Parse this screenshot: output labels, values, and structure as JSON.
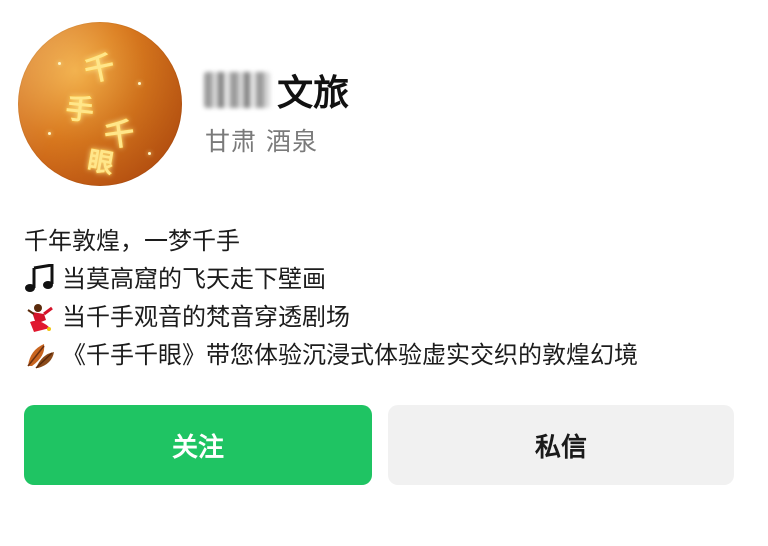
{
  "profile": {
    "name_suffix": "文旅",
    "location": "甘肃 酒泉",
    "avatar_text": [
      "千",
      "手",
      "千",
      "眼"
    ]
  },
  "bio": {
    "line1": "千年敦煌，一梦千手",
    "line2": "当莫高窟的飞天走下壁画",
    "line3": "当千手观音的梵音穿透剧场",
    "line4": "《千手千眼》带您体验沉浸式体验虚实交织的敦煌幻境",
    "icons": [
      "music-note-icon",
      "dancer-icon",
      "autumn-leaf-icon"
    ]
  },
  "actions": {
    "follow_label": "关注",
    "message_label": "私信"
  },
  "colors": {
    "follow_bg": "#1fc463",
    "message_bg": "#f1f1f1",
    "location_text": "#7a7a7a"
  }
}
